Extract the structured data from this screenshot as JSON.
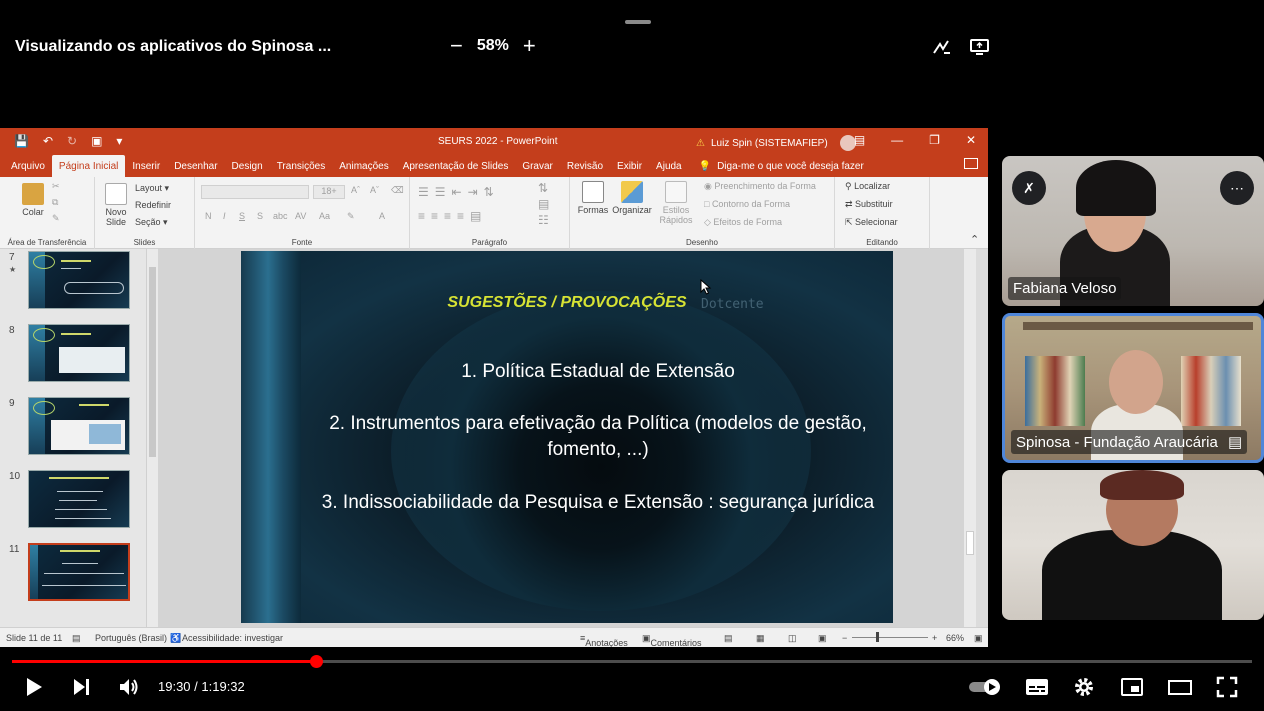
{
  "meeting": {
    "title": "Visualizando os aplicativos do Spinosa ...",
    "zoom_minus": "−",
    "zoom_level": "58%",
    "zoom_plus": "+"
  },
  "powerpoint": {
    "window_title": "SEURS 2022 - PowerPoint",
    "user_name": "Luiz Spin (SISTEMAFIEP)",
    "tabs": [
      "Arquivo",
      "Página Inicial",
      "Inserir",
      "Desenhar",
      "Design",
      "Transições",
      "Animações",
      "Apresentação de Slides",
      "Gravar",
      "Revisão",
      "Exibir",
      "Ajuda"
    ],
    "active_tab": "Página Inicial",
    "tell_me": "Diga-me o que você deseja fazer",
    "ribbon": {
      "paste": "Colar",
      "clipboard_group": "Área de Transferência",
      "new_slide": "Novo Slide",
      "layout": "Layout",
      "reset": "Redefinir",
      "section": "Seção",
      "slides_group": "Slides",
      "font_size": "18+",
      "bold": "N",
      "italic": "I",
      "underline": "S",
      "strike": "S",
      "char_spacing": "abc",
      "change_case": "AV",
      "font_size_menu": "Aa",
      "font_color": "A",
      "font_group": "Fonte",
      "paragraph_group": "Parágrafo",
      "shapes": "Formas",
      "arrange": "Organizar",
      "quick_styles": "Estilos Rápidos",
      "shape_fill": "Preenchimento da Forma",
      "shape_outline": "Contorno da Forma",
      "shape_effects": "Efeitos de Forma",
      "drawing_group": "Desenho",
      "find": "Localizar",
      "replace": "Substituir",
      "select": "Selecionar",
      "editing_group": "Editando"
    },
    "thumbnails": [
      {
        "number": "7",
        "star": "★"
      },
      {
        "number": "8",
        "star": ""
      },
      {
        "number": "9",
        "star": ""
      },
      {
        "number": "10",
        "star": ""
      },
      {
        "number": "11",
        "star": ""
      }
    ],
    "slide": {
      "title": "SUGESTÕES / PROVOCAÇÕES",
      "item1": "1.  Política Estadual de Extensão",
      "item2_line1": "2.  Instrumentos para efetivação da Política (modelos de gestão,",
      "item2_line2": "fomento, ...)",
      "item3": "3.  Indissociabilidade da Pesquisa e Extensão : segurança jurídica",
      "background_text": "Dotcente"
    },
    "status": {
      "slide_counter": "Slide 11 de 11",
      "language": "Português (Brasil)",
      "accessibility": "Acessibilidade: investigar",
      "notes": "Anotações",
      "comments": "Comentários",
      "zoom": "66%"
    }
  },
  "participants": [
    {
      "name": "Fabiana Veloso"
    },
    {
      "name": "Spinosa - Fundação Araucária"
    },
    {
      "name": ""
    }
  ],
  "player": {
    "current_time": "19:30",
    "separator": " / ",
    "duration": "1:19:32",
    "progress": 0.245
  },
  "colors": {
    "ppt_accent": "#c43e1c",
    "slide_title": "#d6e234",
    "progress": "#ff0000",
    "active_speaker": "#4f86d9"
  }
}
